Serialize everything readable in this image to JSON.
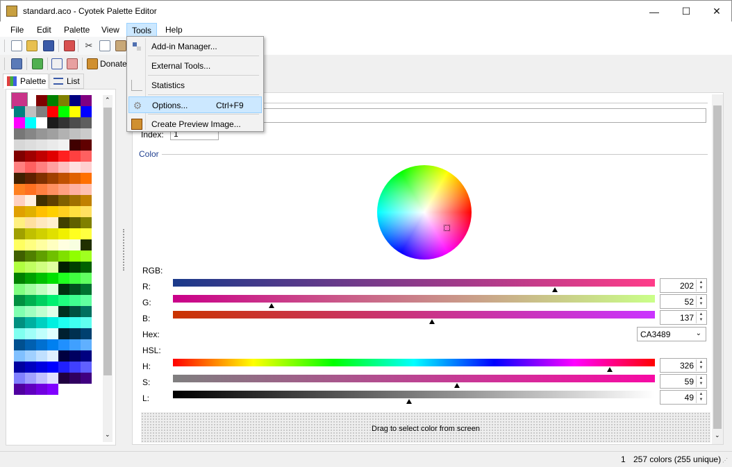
{
  "window": {
    "title": "standard.aco - Cyotek Palette Editor",
    "minimize": "—",
    "maximize": "☐",
    "close": "✕"
  },
  "menu": [
    "File",
    "Edit",
    "Palette",
    "View",
    "Tools",
    "Help"
  ],
  "toolbar": {
    "donate_label": "Donate"
  },
  "tools_menu": {
    "items": [
      {
        "label": "Add-in Manager...",
        "shortcut": ""
      },
      {
        "label": "External Tools...",
        "shortcut": ""
      },
      {
        "label": "Statistics",
        "shortcut": ""
      },
      {
        "label": "Options...",
        "shortcut": "Ctrl+F9"
      },
      {
        "label": "Create Preview Image...",
        "shortcut": ""
      }
    ]
  },
  "tabs": {
    "palette": "Palette",
    "list": "List"
  },
  "details": {
    "index_label": "Index:",
    "index_value": "1",
    "name_value": "",
    "color_header": "Color",
    "rgb_label": "RGB:",
    "hex_label": "Hex:",
    "hsl_label": "HSL:"
  },
  "selected_color": "#CA3489",
  "rgb": [
    {
      "label": "R:",
      "value": "202",
      "level": 0.792,
      "from": "#1a3a8a",
      "to": "#ff3c89"
    },
    {
      "label": "G:",
      "value": "52",
      "level": 0.204,
      "from": "#ca0089",
      "to": "#caff89"
    },
    {
      "label": "B:",
      "value": "137",
      "level": 0.537,
      "from": "#ca3400",
      "to": "#ca34ff"
    }
  ],
  "hex_value": "CA3489",
  "hsl": [
    {
      "label": "H:",
      "value": "326",
      "level": 0.906
    },
    {
      "label": "S:",
      "value": "59",
      "level": 0.59
    },
    {
      "label": "L:",
      "value": "49",
      "level": 0.49
    }
  ],
  "dropzone_text": "Drag to select color from screen",
  "status": {
    "index": "1",
    "count": "257 colors (255 unique)"
  },
  "palette_swatches": [
    "#ca3489",
    "#800000",
    "#008000",
    "#808000",
    "#000080",
    "#800080",
    "#008080",
    "#c0c0c0",
    "#808080",
    "#ff0000",
    "#00ff00",
    "#ffff00",
    "#0000ff",
    "#ff00ff",
    "#00ffff",
    "#ffffff",
    "#1c1c1c",
    "#333333",
    "#4d4d4d",
    "#5f5f5f",
    "#777777",
    "#868686",
    "#969696",
    "#a0a0a0",
    "#b2b2b2",
    "#c0c0c0",
    "#cbcbcb",
    "#d7d7d7",
    "#dddddd",
    "#e3e3e3",
    "#eaeaea",
    "#f1f1f1",
    "#400000",
    "#600000",
    "#800000",
    "#a00000",
    "#c00000",
    "#e00000",
    "#ff2020",
    "#ff4040",
    "#ff6060",
    "#ff8080",
    "#ff6060",
    "#ff8080",
    "#ffa0a0",
    "#ffc0c0",
    "#ffe0e0",
    "#ffd0d0",
    "#402000",
    "#602000",
    "#803000",
    "#a04000",
    "#c05000",
    "#e06000",
    "#ff7000",
    "#ff8020",
    "#ff7020",
    "#ff8040",
    "#ff9060",
    "#ffa080",
    "#ffb0a0",
    "#ffc0b0",
    "#ffd0c0",
    "#fff0e0",
    "#403000",
    "#604000",
    "#806000",
    "#a07000",
    "#c08000",
    "#e0a000",
    "#e0b000",
    "#ffc000",
    "#ffd000",
    "#ffd020",
    "#ffe040",
    "#ffe060",
    "#fff080",
    "#ffe0a0",
    "#ffe8c0",
    "#fff0d0",
    "#404000",
    "#606000",
    "#808000",
    "#a0a000",
    "#c0c000",
    "#d0d000",
    "#e0e000",
    "#f0f000",
    "#ffff20",
    "#ffff40",
    "#ffff60",
    "#ffff80",
    "#ffffa0",
    "#ffffc0",
    "#ffffe0",
    "#f8ffe0",
    "#203000",
    "#406000",
    "#508000",
    "#60a000",
    "#70c000",
    "#80e000",
    "#90ff00",
    "#a0ff20",
    "#b0ff40",
    "#c0ff60",
    "#d0ff80",
    "#e0ffa0",
    "#002000",
    "#004000",
    "#006000",
    "#008000",
    "#00a000",
    "#00c000",
    "#00e000",
    "#20ff20",
    "#40ff40",
    "#60ff60",
    "#80ff80",
    "#a0ffa0",
    "#c0ffc0",
    "#e0ffe0",
    "#003010",
    "#005020",
    "#007030",
    "#009040",
    "#00b050",
    "#00d060",
    "#00f070",
    "#20ff80",
    "#40ff90",
    "#60ffa0",
    "#80ffb0",
    "#a0ffc0",
    "#c0ffd0",
    "#e0ffe8",
    "#003020",
    "#005040",
    "#007060",
    "#009080",
    "#00b0a0",
    "#00d0c0",
    "#00f0e0",
    "#20fff0",
    "#40fff0",
    "#60fff0",
    "#80fff0",
    "#a0fff8",
    "#c0fffc",
    "#e0ffff",
    "#002030",
    "#003050",
    "#004070",
    "#005090",
    "#0060b0",
    "#0070d0",
    "#0080f0",
    "#2090ff",
    "#40a0ff",
    "#60b0ff",
    "#80c0ff",
    "#a0d0ff",
    "#c0e0ff",
    "#e0f0ff",
    "#000040",
    "#000060",
    "#000080",
    "#0000a0",
    "#0000c0",
    "#0000e0",
    "#0000ff",
    "#2020ff",
    "#4040ff",
    "#6060ff",
    "#8080ff",
    "#a0a0ff",
    "#c0c0ff",
    "#e0e0ff",
    "#200040",
    "#300060",
    "#400080",
    "#5000a0",
    "#6000c0",
    "#7000e0",
    "#8000ff"
  ]
}
